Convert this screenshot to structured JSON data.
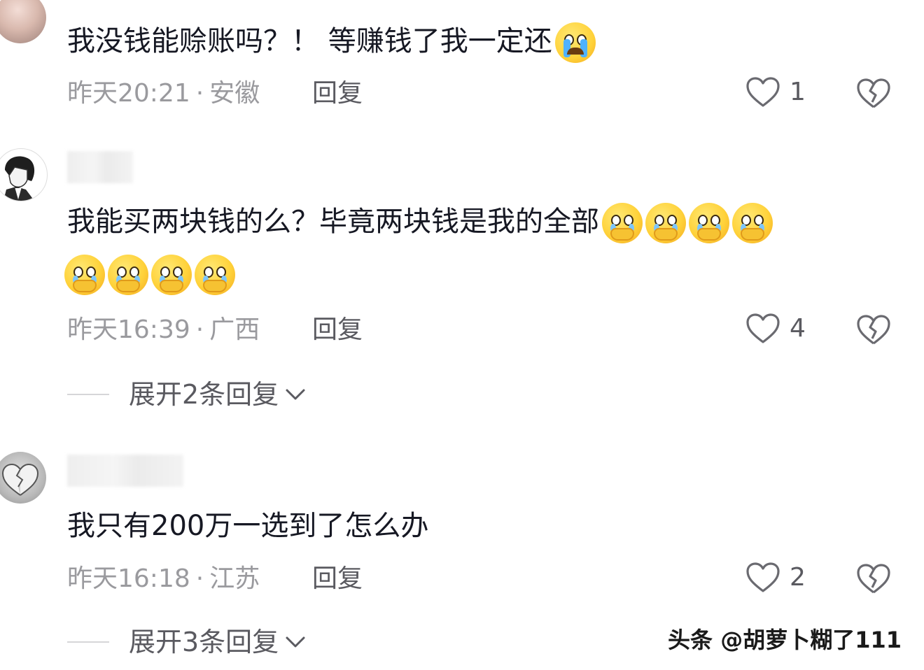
{
  "comments": [
    {
      "text": "我没钱能赊账吗？！ 等赚钱了我一定还",
      "time": "昨天20:21",
      "location": "安徽",
      "reply_label": "回复",
      "likes": "1",
      "emoji": [
        "loudly-crying"
      ]
    },
    {
      "text": "我能买两块钱的么？毕竟两块钱是我的全部",
      "time": "昨天16:39",
      "location": "广西",
      "reply_label": "回复",
      "likes": "4",
      "emoji": [
        "holding-back-tears",
        "holding-back-tears",
        "holding-back-tears",
        "holding-back-tears",
        "holding-back-tears",
        "holding-back-tears",
        "holding-back-tears",
        "holding-back-tears"
      ],
      "expand_label": "展开2条回复"
    },
    {
      "text": "我只有200万一选到了怎么办",
      "time": "昨天16:18",
      "location": "江苏",
      "reply_label": "回复",
      "likes": "2",
      "expand_label": "展开3条回复"
    }
  ],
  "meta_separator": "·",
  "watermark": "头条 @胡萝卜糊了111",
  "colors": {
    "text_primary": "#161823",
    "text_meta": "#9a9a9e",
    "text_action": "#5a5a60",
    "divider": "#d6d6d8"
  }
}
